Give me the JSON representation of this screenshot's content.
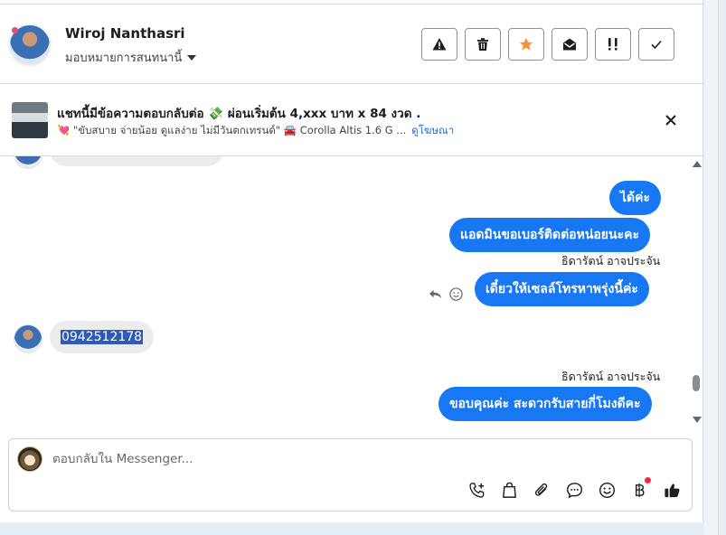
{
  "header": {
    "contact_name": "Wiroj Nanthasri",
    "assign_label": "มอบหมายการสนทนานี้",
    "actions": [
      {
        "name": "spam-button",
        "icon": "warning-icon"
      },
      {
        "name": "delete-button",
        "icon": "trash-icon"
      },
      {
        "name": "star-button",
        "icon": "star-icon",
        "color": "#f7923a"
      },
      {
        "name": "mark-unread-button",
        "icon": "envelope-open-icon"
      },
      {
        "name": "follow-up-button",
        "icon": "exclamation-icon"
      },
      {
        "name": "mark-done-button",
        "icon": "check-icon"
      }
    ]
  },
  "ad": {
    "title": "แชทนี้มีข้อความตอบกลับต่อ 💸 ผ่อนเริ่มต้น 4,xxx บาท x 84 งวด .",
    "subtitle": "💘 \"ขับสบาย จ่ายน้อย ดูแลง่าย ไม่มีวันตกเทรนด์\" 🚘 Corolla Altis 1.6 G ...",
    "link_label": "ดูโฆษณา"
  },
  "messages": {
    "out_1": "ได้ค่ะ",
    "out_2": "แอดมินขอเบอร์ติดต่อหน่อยนะคะ",
    "sender_1": "ธิดารัตน์ อาจประจัน",
    "out_3": "เดี๋ยวให้เซลล์โทรหาพรุ่งนี้ค่ะ",
    "in_phone": "0942512178",
    "sender_2": "ธิดารัตน์ อาจประจัน",
    "out_4": "ขอบคุณค่ะ สะดวกรับสายกี่โมงดีคะ"
  },
  "composer": {
    "placeholder": "ตอบกลับใน Messenger...",
    "tools": [
      "add-call-icon",
      "shopping-bag-icon",
      "paperclip-icon",
      "saved-reply-icon",
      "emoji-icon",
      "baht-icon",
      "thumbs-up-icon"
    ]
  },
  "colors": {
    "accent": "#1877f2",
    "star": "#f7923a",
    "selection": "#2e5bb8",
    "notification_dot": "#f0284a"
  }
}
